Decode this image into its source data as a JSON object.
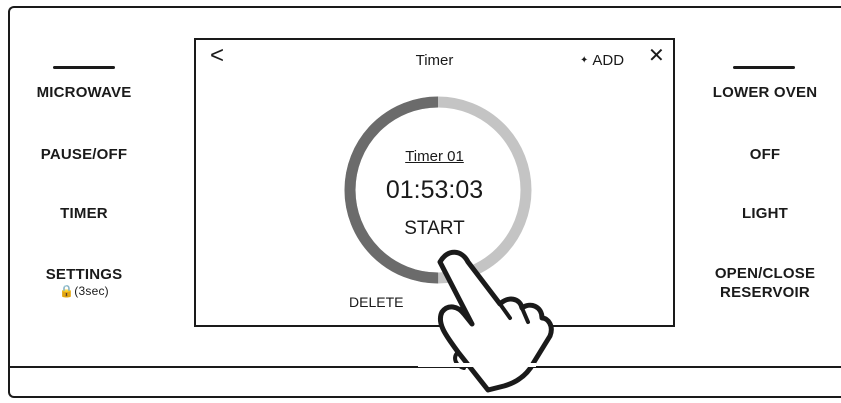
{
  "left_buttons": [
    {
      "label": "MICROWAVE",
      "sub": ""
    },
    {
      "label": "PAUSE/OFF",
      "sub": ""
    },
    {
      "label": "TIMER",
      "sub": ""
    },
    {
      "label": "SETTINGS",
      "sub": "🔒(3sec)"
    }
  ],
  "right_buttons": [
    {
      "label": "LOWER OVEN"
    },
    {
      "label": "OFF"
    },
    {
      "label": "LIGHT"
    },
    {
      "label": "OPEN/CLOSE\nRESERVOIR"
    }
  ],
  "screen": {
    "back_icon": "<",
    "title": "Timer",
    "add_label": "ADD",
    "close_icon": "✕",
    "timer_name": "Timer 01",
    "time": "01:53:03",
    "start_label": "START",
    "delete_label": "DELETE",
    "progress": 0.5
  },
  "colors": {
    "ring_active": "#6b6b6b",
    "ring_track": "#c4c4c4",
    "line": "#1a1a1a"
  }
}
